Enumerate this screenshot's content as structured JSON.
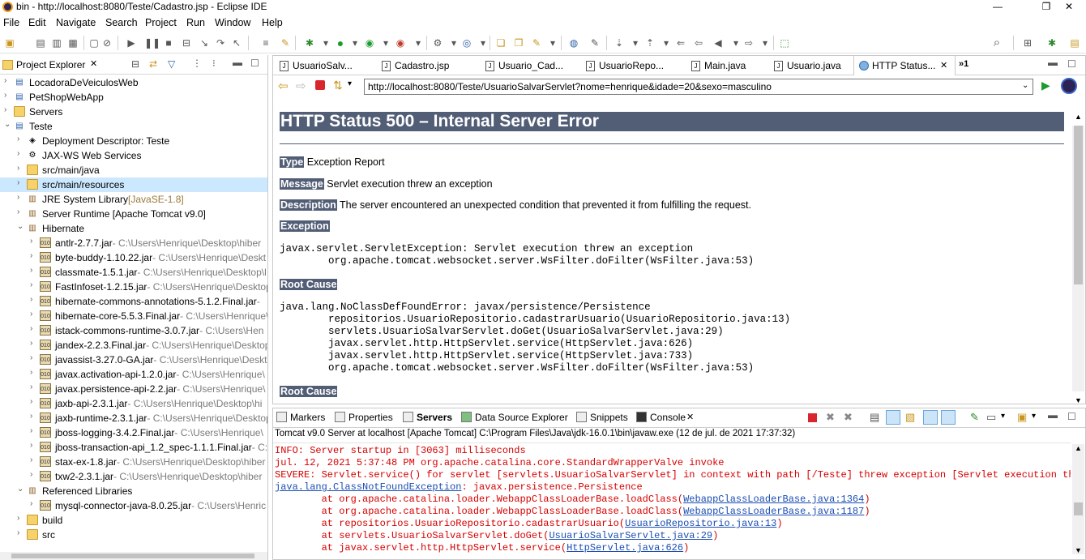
{
  "window": {
    "title": "bin - http://localhost:8080/Teste/Cadastro.jsp - Eclipse IDE",
    "minimize_glyph": "—",
    "restore_glyph": "❐",
    "close_glyph": "✕"
  },
  "menu": [
    "File",
    "Edit",
    "Navigate",
    "Search",
    "Project",
    "Run",
    "Window",
    "Help"
  ],
  "explorer": {
    "tab_label": "Project Explorer",
    "tree": [
      {
        "depth": 0,
        "expanded": false,
        "icon": "project-icon",
        "label": "LocadoraDeVeiculosWeb",
        "path": ""
      },
      {
        "depth": 0,
        "expanded": false,
        "icon": "project-icon",
        "label": "PetShopWebApp",
        "path": ""
      },
      {
        "depth": 0,
        "expanded": false,
        "icon": "folder-icon",
        "label": "Servers",
        "path": ""
      },
      {
        "depth": 0,
        "expanded": true,
        "icon": "project-icon",
        "label": "Teste",
        "path": ""
      },
      {
        "depth": 1,
        "expanded": false,
        "icon": "descriptor-icon",
        "label": "Deployment Descriptor: Teste",
        "path": ""
      },
      {
        "depth": 1,
        "expanded": false,
        "icon": "webservices-icon",
        "label": "JAX-WS Web Services",
        "path": ""
      },
      {
        "depth": 1,
        "expanded": false,
        "icon": "source-folder-icon",
        "label": "src/main/java",
        "path": ""
      },
      {
        "depth": 1,
        "expanded": false,
        "icon": "source-folder-icon",
        "label": "src/main/resources",
        "path": "",
        "selected": true
      },
      {
        "depth": 1,
        "expanded": false,
        "icon": "library-icon",
        "label": "JRE System Library",
        "path": "[JavaSE-1.8]"
      },
      {
        "depth": 1,
        "expanded": false,
        "icon": "library-icon",
        "label": "Server Runtime [Apache Tomcat v9.0]",
        "path": ""
      },
      {
        "depth": 1,
        "expanded": true,
        "icon": "library-icon",
        "label": "Hibernate",
        "path": ""
      },
      {
        "depth": 2,
        "expanded": false,
        "icon": "jar-icon",
        "label": "antlr-2.7.7.jar",
        "path": "- C:\\Users\\Henrique\\Desktop\\hiber"
      },
      {
        "depth": 2,
        "expanded": false,
        "icon": "jar-icon",
        "label": "byte-buddy-1.10.22.jar",
        "path": "- C:\\Users\\Henrique\\Deskt"
      },
      {
        "depth": 2,
        "expanded": false,
        "icon": "jar-icon",
        "label": "classmate-1.5.1.jar",
        "path": "- C:\\Users\\Henrique\\Desktop\\l"
      },
      {
        "depth": 2,
        "expanded": false,
        "icon": "jar-icon",
        "label": "FastInfoset-1.2.15.jar",
        "path": "- C:\\Users\\Henrique\\Desktop"
      },
      {
        "depth": 2,
        "expanded": false,
        "icon": "jar-icon",
        "label": "hibernate-commons-annotations-5.1.2.Final.jar",
        "path": "-"
      },
      {
        "depth": 2,
        "expanded": false,
        "icon": "jar-icon",
        "label": "hibernate-core-5.5.3.Final.jar",
        "path": "- C:\\Users\\Henrique\\"
      },
      {
        "depth": 2,
        "expanded": false,
        "icon": "jar-icon",
        "label": "istack-commons-runtime-3.0.7.jar",
        "path": "- C:\\Users\\Hen"
      },
      {
        "depth": 2,
        "expanded": false,
        "icon": "jar-icon",
        "label": "jandex-2.2.3.Final.jar",
        "path": "- C:\\Users\\Henrique\\Desktop"
      },
      {
        "depth": 2,
        "expanded": false,
        "icon": "jar-icon",
        "label": "javassist-3.27.0-GA.jar",
        "path": "- C:\\Users\\Henrique\\Deskt"
      },
      {
        "depth": 2,
        "expanded": false,
        "icon": "jar-icon",
        "label": "javax.activation-api-1.2.0.jar",
        "path": "- C:\\Users\\Henrique\\"
      },
      {
        "depth": 2,
        "expanded": false,
        "icon": "jar-icon",
        "label": "javax.persistence-api-2.2.jar",
        "path": "- C:\\Users\\Henrique\\"
      },
      {
        "depth": 2,
        "expanded": false,
        "icon": "jar-icon",
        "label": "jaxb-api-2.3.1.jar",
        "path": "- C:\\Users\\Henrique\\Desktop\\hi"
      },
      {
        "depth": 2,
        "expanded": false,
        "icon": "jar-icon",
        "label": "jaxb-runtime-2.3.1.jar",
        "path": "- C:\\Users\\Henrique\\Desktop"
      },
      {
        "depth": 2,
        "expanded": false,
        "icon": "jar-icon",
        "label": "jboss-logging-3.4.2.Final.jar",
        "path": "- C:\\Users\\Henrique\\"
      },
      {
        "depth": 2,
        "expanded": false,
        "icon": "jar-icon",
        "label": "jboss-transaction-api_1.2_spec-1.1.1.Final.jar",
        "path": "- C:\\"
      },
      {
        "depth": 2,
        "expanded": false,
        "icon": "jar-icon",
        "label": "stax-ex-1.8.jar",
        "path": "- C:\\Users\\Henrique\\Desktop\\hiber"
      },
      {
        "depth": 2,
        "expanded": false,
        "icon": "jar-icon",
        "label": "txw2-2.3.1.jar",
        "path": "- C:\\Users\\Henrique\\Desktop\\hiber"
      },
      {
        "depth": 1,
        "expanded": true,
        "icon": "library-icon",
        "label": "Referenced Libraries",
        "path": ""
      },
      {
        "depth": 2,
        "expanded": false,
        "icon": "jar-icon",
        "label": "mysql-connector-java-8.0.25.jar",
        "path": "- C:\\Users\\Henric"
      },
      {
        "depth": 1,
        "expanded": false,
        "icon": "folder-icon",
        "label": "build",
        "path": ""
      },
      {
        "depth": 1,
        "expanded": false,
        "icon": "folder-icon",
        "label": "src",
        "path": ""
      }
    ]
  },
  "editor": {
    "tabs": [
      {
        "label": "UsuarioSalv...",
        "active": false
      },
      {
        "label": "Cadastro.jsp",
        "active": false
      },
      {
        "label": "Usuario_Cad...",
        "active": false
      },
      {
        "label": "UsuarioRepo...",
        "active": false
      },
      {
        "label": "Main.java",
        "active": false
      },
      {
        "label": "Usuario.java",
        "active": false
      },
      {
        "label": "HTTP Status...",
        "active": true
      }
    ],
    "overflow_label": "»1",
    "url": "http://localhost:8080/Teste/UsuarioSalvarServlet?nome=henrique&idade=20&sexo=masculino",
    "page": {
      "heading": "HTTP Status 500 – Internal Server Error",
      "type_label": "Type",
      "type_value": "Exception Report",
      "message_label": "Message",
      "message_value": "Servlet execution threw an exception",
      "description_label": "Description",
      "description_value": "The server encountered an unexpected condition that prevented it from fulfilling the request.",
      "exception_label": "Exception",
      "exception_trace": "javax.servlet.ServletException: Servlet execution threw an exception\n\torg.apache.tomcat.websocket.server.WsFilter.doFilter(WsFilter.java:53)",
      "root_cause_label": "Root Cause",
      "root_cause_trace": "java.lang.NoClassDefFoundError: javax/persistence/Persistence\n\trepositorios.UsuarioRepositorio.cadastrarUsuario(UsuarioRepositorio.java:13)\n\tservlets.UsuarioSalvarServlet.doGet(UsuarioSalvarServlet.java:29)\n\tjavax.servlet.http.HttpServlet.service(HttpServlet.java:626)\n\tjavax.servlet.http.HttpServlet.service(HttpServlet.java:733)\n\torg.apache.tomcat.websocket.server.WsFilter.doFilter(WsFilter.java:53)",
      "root_cause_label_2": "Root Cause"
    }
  },
  "bottom_panel": {
    "tabs": [
      {
        "label": "Markers",
        "bold": false
      },
      {
        "label": "Properties",
        "bold": false
      },
      {
        "label": "Servers",
        "bold": true
      },
      {
        "label": "Data Source Explorer",
        "bold": false
      },
      {
        "label": "Snippets",
        "bold": false
      },
      {
        "label": "Console",
        "bold": false,
        "active": true
      }
    ],
    "console_description": "Tomcat v9.0 Server at localhost [Apache Tomcat] C:\\Program Files\\Java\\jdk-16.0.1\\bin\\javaw.exe  (12 de jul. de 2021 17:37:32)",
    "lines": [
      {
        "text": "INFO: Server startup in [3063] milliseconds"
      },
      {
        "text": "jul. 12, 2021 5:37:48 PM org.apache.catalina.core.StandardWrapperValve invoke"
      },
      {
        "text": "SEVERE: Servlet.service() for servlet [servlets.UsuarioSalvarServlet] in context with path [/Teste] threw exception [Servlet execution threw"
      },
      {
        "pre": "",
        "link": "java.lang.ClassNotFoundException",
        "post": ": javax.persistence.Persistence"
      },
      {
        "pre": "\tat org.apache.catalina.loader.WebappClassLoaderBase.loadClass(",
        "link": "WebappClassLoaderBase.java:1364",
        "post": ")"
      },
      {
        "pre": "\tat org.apache.catalina.loader.WebappClassLoaderBase.loadClass(",
        "link": "WebappClassLoaderBase.java:1187",
        "post": ")"
      },
      {
        "pre": "\tat repositorios.UsuarioRepositorio.cadastrarUsuario(",
        "link": "UsuarioRepositorio.java:13",
        "post": ")"
      },
      {
        "pre": "\tat servlets.UsuarioSalvarServlet.doGet(",
        "link": "UsuarioSalvarServlet.java:29",
        "post": ")"
      },
      {
        "pre": "\tat javax.servlet.http.HttpServlet.service(",
        "link": "HttpServlet.java:626",
        "post": ")"
      }
    ]
  },
  "colors": {
    "tomcat_header": "#525d76",
    "console_error": "#d60000",
    "console_link": "#1a4db3",
    "selection": "#cce8ff"
  }
}
